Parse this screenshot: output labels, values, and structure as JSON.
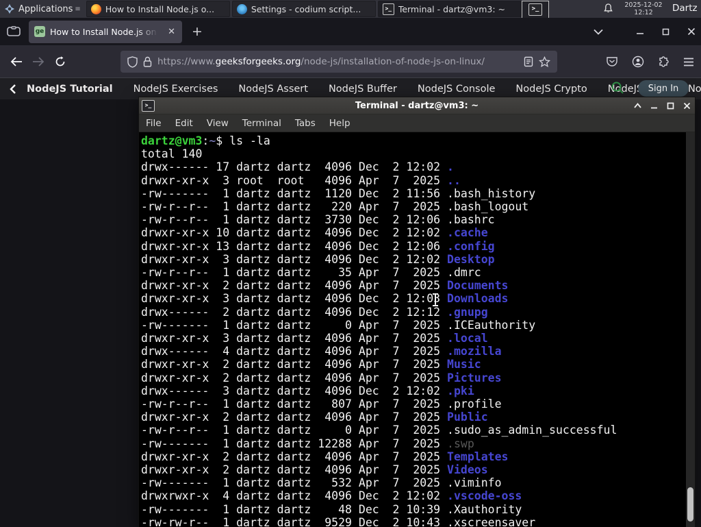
{
  "panel": {
    "applications_label": "Applications",
    "tasks": [
      {
        "label": "How to Install Node.js o...",
        "icon": "firefox"
      },
      {
        "label": "Settings - codium script...",
        "icon": "codium"
      },
      {
        "label": "Terminal - dartz@vm3: ~",
        "icon": "terminal"
      }
    ],
    "clock_date": "2025-12-02",
    "clock_time": "12:12",
    "user_label": "Dartz"
  },
  "browser": {
    "tab_title": "How to Install Node.js on",
    "new_tab_label": "+",
    "close_tab_label": "✕",
    "url": {
      "scheme": "https://www.",
      "domain": "geeksforgeeks.org",
      "path": "/node-js/installation-of-node-js-on-linux/"
    },
    "navbar": {
      "items": [
        {
          "label": "NodeJS Tutorial"
        },
        {
          "label": "NodeJS Exercises"
        },
        {
          "label": "NodeJS Assert"
        },
        {
          "label": "NodeJS Buffer"
        },
        {
          "label": "NodeJS Console"
        },
        {
          "label": "NodeJS Crypto"
        },
        {
          "label": "NodeJS DNS"
        },
        {
          "label": "Node"
        }
      ],
      "signin_label": "Sign In",
      "search_color": "#2f8d46"
    }
  },
  "terminal": {
    "title": "Terminal - dartz@vm3: ~",
    "menu": [
      {
        "label": "File"
      },
      {
        "label": "Edit"
      },
      {
        "label": "View"
      },
      {
        "label": "Terminal"
      },
      {
        "label": "Tabs"
      },
      {
        "label": "Help"
      }
    ],
    "prompt": {
      "user_host": "dartz@vm3",
      "colon": ":",
      "cwd": "~",
      "dollar": "$ ",
      "command": "ls -la"
    },
    "total_line": "total 140",
    "listing": [
      {
        "pre": "drwx------ 17 dartz dartz  4096 Dec  2 12:02 ",
        "name": ".",
        "type": "dir"
      },
      {
        "pre": "drwxr-xr-x  3 root  root   4096 Apr  7  2025 ",
        "name": "..",
        "type": "dir"
      },
      {
        "pre": "-rw-------  1 dartz dartz  1120 Dec  2 11:56 ",
        "name": ".bash_history",
        "type": "file"
      },
      {
        "pre": "-rw-r--r--  1 dartz dartz   220 Apr  7  2025 ",
        "name": ".bash_logout",
        "type": "file"
      },
      {
        "pre": "-rw-r--r--  1 dartz dartz  3730 Dec  2 12:06 ",
        "name": ".bashrc",
        "type": "file"
      },
      {
        "pre": "drwxr-xr-x 10 dartz dartz  4096 Dec  2 12:02 ",
        "name": ".cache",
        "type": "dir"
      },
      {
        "pre": "drwxr-xr-x 13 dartz dartz  4096 Dec  2 12:06 ",
        "name": ".config",
        "type": "dir"
      },
      {
        "pre": "drwxr-xr-x  3 dartz dartz  4096 Dec  2 12:02 ",
        "name": "Desktop",
        "type": "dir"
      },
      {
        "pre": "-rw-r--r--  1 dartz dartz    35 Apr  7  2025 ",
        "name": ".dmrc",
        "type": "file"
      },
      {
        "pre": "drwxr-xr-x  2 dartz dartz  4096 Apr  7  2025 ",
        "name": "Documents",
        "type": "dir"
      },
      {
        "pre": "drwxr-xr-x  3 dartz dartz  4096 Dec  2 12:03 ",
        "name": "Downloads",
        "type": "dir"
      },
      {
        "pre": "drwx------  2 dartz dartz  4096 Dec  2 12:12 ",
        "name": ".gnupg",
        "type": "dir"
      },
      {
        "pre": "-rw-------  1 dartz dartz     0 Apr  7  2025 ",
        "name": ".ICEauthority",
        "type": "file"
      },
      {
        "pre": "drwxr-xr-x  3 dartz dartz  4096 Apr  7  2025 ",
        "name": ".local",
        "type": "dir"
      },
      {
        "pre": "drwx------  4 dartz dartz  4096 Apr  7  2025 ",
        "name": ".mozilla",
        "type": "dir"
      },
      {
        "pre": "drwxr-xr-x  2 dartz dartz  4096 Apr  7  2025 ",
        "name": "Music",
        "type": "dir"
      },
      {
        "pre": "drwxr-xr-x  2 dartz dartz  4096 Apr  7  2025 ",
        "name": "Pictures",
        "type": "dir"
      },
      {
        "pre": "drwx------  3 dartz dartz  4096 Dec  2 12:02 ",
        "name": ".pki",
        "type": "dir"
      },
      {
        "pre": "-rw-r--r--  1 dartz dartz   807 Apr  7  2025 ",
        "name": ".profile",
        "type": "file"
      },
      {
        "pre": "drwxr-xr-x  2 dartz dartz  4096 Apr  7  2025 ",
        "name": "Public",
        "type": "dir"
      },
      {
        "pre": "-rw-r--r--  1 dartz dartz     0 Apr  7  2025 ",
        "name": ".sudo_as_admin_successful",
        "type": "file"
      },
      {
        "pre": "-rw-------  1 dartz dartz 12288 Apr  7  2025 ",
        "name": ".swp",
        "type": "dim"
      },
      {
        "pre": "drwxr-xr-x  2 dartz dartz  4096 Apr  7  2025 ",
        "name": "Templates",
        "type": "dir"
      },
      {
        "pre": "drwxr-xr-x  2 dartz dartz  4096 Apr  7  2025 ",
        "name": "Videos",
        "type": "dir"
      },
      {
        "pre": "-rw-------  1 dartz dartz   532 Apr  7  2025 ",
        "name": ".viminfo",
        "type": "file"
      },
      {
        "pre": "drwxrwxr-x  4 dartz dartz  4096 Dec  2 12:02 ",
        "name": ".vscode-oss",
        "type": "dir"
      },
      {
        "pre": "-rw-------  1 dartz dartz    48 Dec  2 10:39 ",
        "name": ".Xauthority",
        "type": "file"
      },
      {
        "pre": "-rw-rw-r--  1 dartz dartz  9529 Dec  2 10:43 ",
        "name": ".xscreensaver",
        "type": "file"
      }
    ],
    "colors": {
      "background": "#000000",
      "foreground": "#f2f2f2",
      "prompt_green": "#3bd33b",
      "directory_blue": "#4646d2",
      "dim_gray": "#585858"
    }
  }
}
